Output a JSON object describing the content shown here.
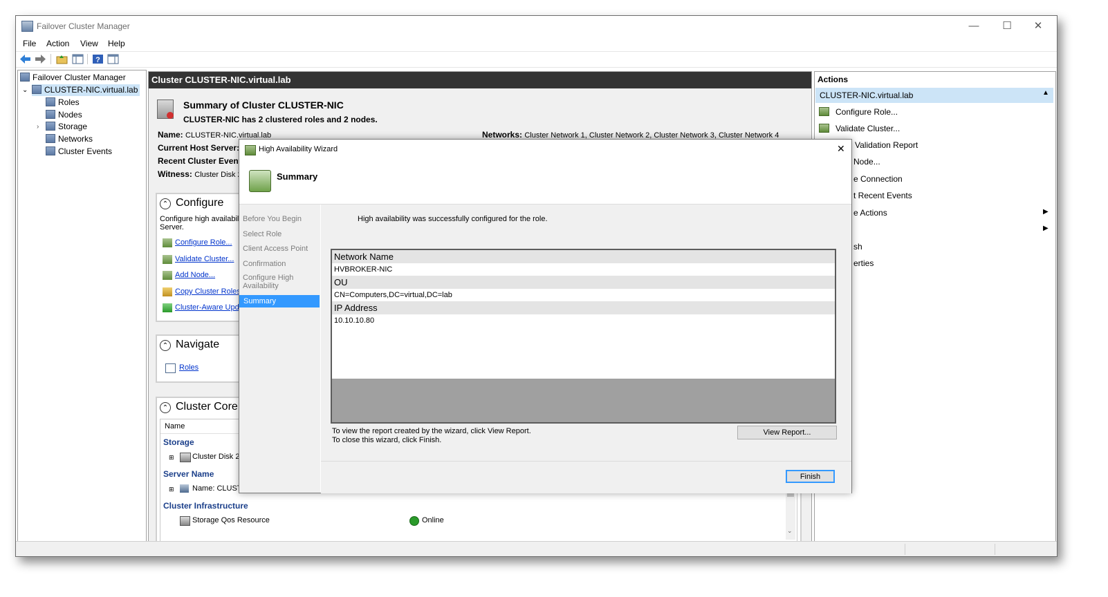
{
  "window": {
    "title": "Failover Cluster Manager",
    "minimize": "—",
    "maximize": "☐",
    "close": "✕"
  },
  "menu": [
    "File",
    "Action",
    "View",
    "Help"
  ],
  "tree": {
    "root": "Failover Cluster Manager",
    "cluster": "CLUSTER-NIC.virtual.lab",
    "items": [
      "Roles",
      "Nodes",
      "Storage",
      "Networks",
      "Cluster Events"
    ]
  },
  "center": {
    "header": "Cluster CLUSTER-NIC.virtual.lab",
    "summary_title": "Summary of Cluster CLUSTER-NIC",
    "summary_sub": "CLUSTER-NIC has 2 clustered roles and 2 nodes.",
    "name_label": "Name:",
    "name_value": "CLUSTER-NIC.virtual.lab",
    "host_label": "Current Host Server:",
    "events_label": "Recent Cluster Event",
    "witness_label": "Witness:",
    "witness_value": "Cluster Disk 2",
    "networks_label": "Networks:",
    "networks_value": "Cluster Network 1, Cluster Network 2, Cluster Network 3, Cluster Network 4",
    "configure": {
      "title": "Configure",
      "desc1": "Configure high availabili",
      "desc2": "Server.",
      "links": [
        "Configure Role...",
        "Validate Cluster...",
        "Add Node...",
        "Copy Cluster Roles...",
        "Cluster-Aware Upda"
      ]
    },
    "navigate": {
      "title": "Navigate",
      "links": [
        "Roles"
      ]
    },
    "core": {
      "title": "Cluster Core",
      "col_name": "Name",
      "storage_group": "Storage",
      "storage_item": "Cluster Disk 2",
      "server_group": "Server Name",
      "server_item": "Name: CLUST",
      "infra_group": "Cluster Infrastructure",
      "infra_item": "Storage Qos Resource",
      "infra_status": "Online"
    }
  },
  "actions": {
    "header": "Actions",
    "section": "CLUSTER-NIC.virtual.lab",
    "items": [
      "Configure Role...",
      "Validate Cluster...",
      "Validation Report",
      "Node...",
      "e Connection",
      "t Recent Events",
      "e Actions",
      "",
      "sh",
      "erties"
    ]
  },
  "wizard": {
    "title": "High Availability Wizard",
    "page_title": "Summary",
    "steps": [
      "Before You Begin",
      "Select Role",
      "Client Access Point",
      "Confirmation",
      "Configure High Availability",
      "Summary"
    ],
    "active_step": "Summary",
    "message": "High availability was successfully configured for the role.",
    "report": [
      {
        "header": "Network Name",
        "value": "HVBROKER-NIC"
      },
      {
        "header": "OU",
        "value": "CN=Computers,DC=virtual,DC=lab"
      },
      {
        "header": "IP Address",
        "value": "10.10.10.80"
      }
    ],
    "hint1": "To view the report created by the wizard, click View Report.",
    "hint2": "To close this wizard, click Finish.",
    "view_report": "View Report...",
    "finish": "Finish",
    "close": "✕"
  },
  "colors": {
    "selection": "#3399ff",
    "header_dark": "#343434",
    "link": "#0033cc",
    "actions_section": "#cce4f7"
  }
}
